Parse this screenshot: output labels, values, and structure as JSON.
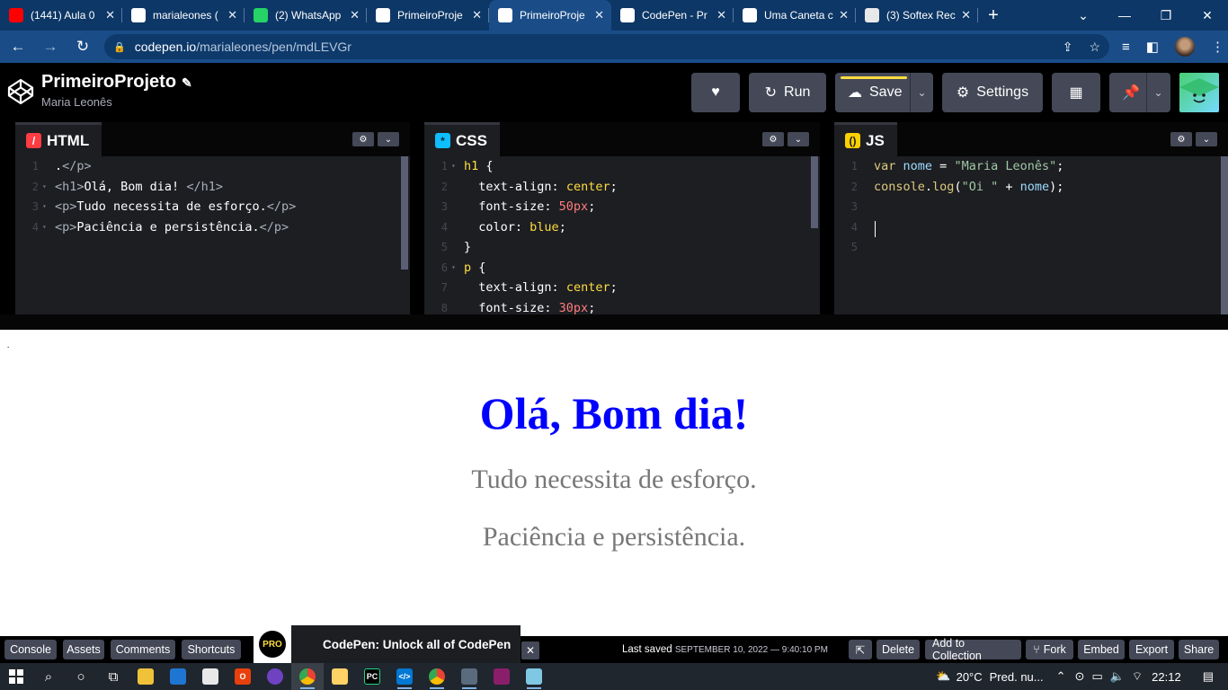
{
  "browser": {
    "tabs": [
      {
        "title": "(1441) Aula 0",
        "favicon_color": "#ff0000",
        "favicon": "youtube-icon",
        "active": false
      },
      {
        "title": "marialeones (",
        "favicon_color": "#ffffff",
        "favicon": "github-icon",
        "active": false
      },
      {
        "title": "(2) WhatsApp",
        "favicon_color": "#25d366",
        "favicon": "whatsapp-icon",
        "active": false
      },
      {
        "title": "PrimeiroProje",
        "favicon_color": "#ffffff",
        "favicon": "codepen-icon",
        "active": false
      },
      {
        "title": "PrimeiroProje",
        "favicon_color": "#ffffff",
        "favicon": "codepen-icon",
        "active": true
      },
      {
        "title": "CodePen - Pr",
        "favicon_color": "#ffffff",
        "favicon": "globe-icon",
        "active": false
      },
      {
        "title": "Uma Caneta c",
        "favicon_color": "#ffffff",
        "favicon": "codepen-icon",
        "active": false
      },
      {
        "title": "(3) Softex Rec",
        "favicon_color": "#e8e8e8",
        "favicon": "softex-icon",
        "active": false
      }
    ],
    "url_domain": "codepen.io",
    "url_path": "/marialeones/pen/mdLEVGr"
  },
  "pen": {
    "title": "PrimeiroProjeto",
    "author": "Maria Leonês",
    "run_label": "Run",
    "save_label": "Save",
    "settings_label": "Settings"
  },
  "editors": {
    "html": {
      "label": "HTML",
      "lines": [
        {
          "n": "1",
          "fold": "",
          "tokens": [
            {
              "c": "t-text",
              "t": "."
            },
            {
              "c": "t-tag",
              "t": "</p>"
            }
          ]
        },
        {
          "n": "2",
          "fold": "▾",
          "tokens": [
            {
              "c": "t-tag",
              "t": "<h1>"
            },
            {
              "c": "t-text",
              "t": "Olá, Bom dia! "
            },
            {
              "c": "t-tag",
              "t": "</h1>"
            }
          ]
        },
        {
          "n": "3",
          "fold": "▾",
          "tokens": [
            {
              "c": "t-tag",
              "t": "<p>"
            },
            {
              "c": "t-text",
              "t": "Tudo necessita de esforço."
            },
            {
              "c": "t-tag",
              "t": "</p>"
            }
          ]
        },
        {
          "n": "4",
          "fold": "▾",
          "tokens": [
            {
              "c": "t-tag",
              "t": "<p>"
            },
            {
              "c": "t-text",
              "t": "Paciência e persistência."
            },
            {
              "c": "t-tag",
              "t": "</p>"
            }
          ]
        }
      ]
    },
    "css": {
      "label": "CSS",
      "lines": [
        {
          "n": "1",
          "fold": "▾",
          "tokens": [
            {
              "c": "t-sel",
              "t": "h1"
            },
            {
              "c": "t-text",
              "t": " {"
            }
          ]
        },
        {
          "n": "2",
          "fold": "",
          "tokens": [
            {
              "c": "t-prop",
              "t": "  text-align"
            },
            {
              "c": "t-text",
              "t": ": "
            },
            {
              "c": "t-val",
              "t": "center"
            },
            {
              "c": "t-text",
              "t": ";"
            }
          ]
        },
        {
          "n": "3",
          "fold": "",
          "tokens": [
            {
              "c": "t-prop",
              "t": "  font-size"
            },
            {
              "c": "t-text",
              "t": ": "
            },
            {
              "c": "t-num",
              "t": "50px"
            },
            {
              "c": "t-text",
              "t": ";"
            }
          ]
        },
        {
          "n": "4",
          "fold": "",
          "tokens": [
            {
              "c": "t-prop",
              "t": "  color"
            },
            {
              "c": "t-text",
              "t": ": "
            },
            {
              "c": "t-val",
              "t": "blue"
            },
            {
              "c": "t-text",
              "t": ";"
            }
          ]
        },
        {
          "n": "5",
          "fold": "",
          "tokens": [
            {
              "c": "t-text",
              "t": "}"
            }
          ]
        },
        {
          "n": "6",
          "fold": "▾",
          "tokens": [
            {
              "c": "t-sel",
              "t": "p"
            },
            {
              "c": "t-text",
              "t": " {"
            }
          ]
        },
        {
          "n": "7",
          "fold": "",
          "tokens": [
            {
              "c": "t-prop",
              "t": "  text-align"
            },
            {
              "c": "t-text",
              "t": ": "
            },
            {
              "c": "t-val",
              "t": "center"
            },
            {
              "c": "t-text",
              "t": ";"
            }
          ]
        },
        {
          "n": "8",
          "fold": "",
          "tokens": [
            {
              "c": "t-prop",
              "t": "  font-size"
            },
            {
              "c": "t-text",
              "t": ": "
            },
            {
              "c": "t-num",
              "t": "30px"
            },
            {
              "c": "t-text",
              "t": ";"
            }
          ]
        }
      ]
    },
    "js": {
      "label": "JS",
      "lines": [
        {
          "n": "1",
          "fold": "",
          "tokens": [
            {
              "c": "t-kw",
              "t": "var"
            },
            {
              "c": "t-text",
              "t": " "
            },
            {
              "c": "t-var",
              "t": "nome"
            },
            {
              "c": "t-text",
              "t": " = "
            },
            {
              "c": "t-str",
              "t": "\"Maria Leonês\""
            },
            {
              "c": "t-text",
              "t": ";"
            }
          ]
        },
        {
          "n": "2",
          "fold": "",
          "tokens": [
            {
              "c": "t-kw",
              "t": "console"
            },
            {
              "c": "t-text",
              "t": "."
            },
            {
              "c": "t-kw",
              "t": "log"
            },
            {
              "c": "t-text",
              "t": "("
            },
            {
              "c": "t-str",
              "t": "\"Oi \""
            },
            {
              "c": "t-text",
              "t": " + "
            },
            {
              "c": "t-var",
              "t": "nome"
            },
            {
              "c": "t-text",
              "t": ");"
            }
          ]
        },
        {
          "n": "3",
          "fold": "",
          "tokens": []
        },
        {
          "n": "4",
          "fold": "",
          "tokens": []
        },
        {
          "n": "5",
          "fold": "",
          "tokens": []
        }
      ]
    }
  },
  "preview": {
    "stray": ".",
    "heading": "Olá, Bom dia!",
    "p1": "Tudo necessita de esforço.",
    "p2": "Paciência e persistência."
  },
  "footer": {
    "console": "Console",
    "assets": "Assets",
    "comments": "Comments",
    "shortcuts": "Shortcuts",
    "promo_badge": "PRO",
    "promo_text": "CodePen: Unlock all of CodePen",
    "last_saved_label": "Last saved",
    "last_saved_date": "SEPTEMBER 10, 2022 — 9:40:10 PM",
    "delete": "Delete",
    "add_to_collection": "Add to Collection",
    "fork": "Fork",
    "embed": "Embed",
    "export": "Export",
    "share": "Share"
  },
  "taskbar": {
    "weather": "20°C",
    "weather_desc": "Pred. nu...",
    "time": "22:12"
  }
}
